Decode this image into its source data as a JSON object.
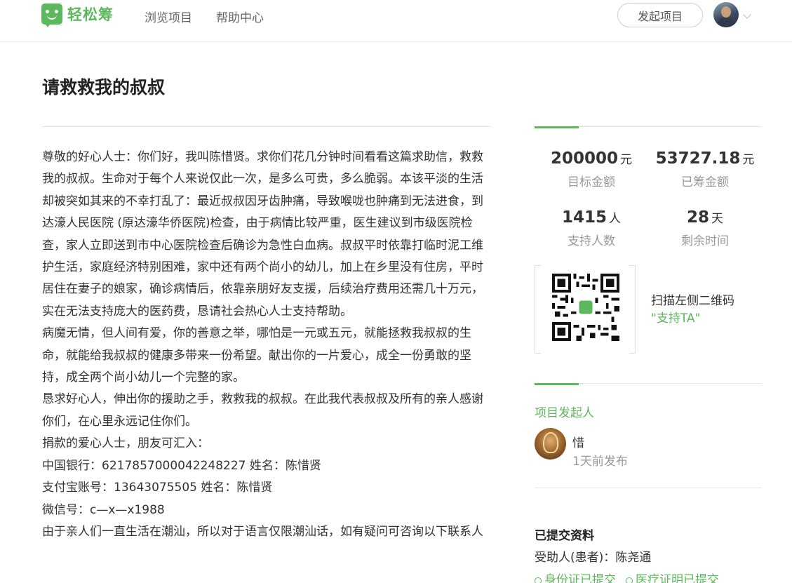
{
  "header": {
    "logo_text": "轻松筹",
    "nav": [
      "浏览项目",
      "帮助中心"
    ],
    "start_button": "发起项目"
  },
  "page_title": "请救救我的叔叔",
  "story": [
    "尊敬的好心人士：你们好，我叫陈惜贤。求你们花几分钟时间看看这篇求助信，救救我的叔叔。生命对于每个人来说仅此一次，是多么可贵，多么脆弱。本该平淡的生活却被突如其来的不幸打乱了：最近叔叔因牙齿肿痛，导致喉咙也肿痛到无法进食，到达濠人民医院 (原达濠华侨医院)检查，由于病情比较严重，医生建议到市级医院检查，家人立即送到市中心医院检查后确诊为急性白血病。叔叔平时依靠打临时泥工维护生活，家庭经济特别困难，家中还有两个尚小的幼儿，加上在乡里没有住房，平时居住在妻子的娘家，确诊病情后，依靠亲朋好友支援，后续治疗费用还需几十万元，实在无法支持庞大的医药费，恳请社会热心人士支持帮助。",
    "病魔无情，但人间有爱，你的善意之举，哪怕是一元或五元，就能拯救我叔叔的生命，就能给我叔叔的健康多带来一份希望。献出你的一片爱心，成全一份勇敢的坚持，成全两个尚小幼儿一个完整的家。",
    "恳求好心人，伸出你的援助之手，救救我的叔叔。在此我代表叔叔及所有的亲人感谢你们，在心里永远记住你们。",
    "捐款的爱心人士，朋友可汇入：",
    "中国银行：6217857000042248227 姓名：陈惜贤",
    "支付宝账号：13643075505 姓名：陈惜贤",
    "微信号：c—x—x1988",
    "由于亲人们一直生活在潮汕，所以对于语言仅限潮汕话，如有疑问可咨询以下联系人"
  ],
  "stats": {
    "target": {
      "value": "200000",
      "unit": "元",
      "label": "目标金额"
    },
    "raised": {
      "value": "53727.18",
      "unit": "元",
      "label": "已筹金额"
    },
    "supporters": {
      "value": "1415",
      "unit": "人",
      "label": "支持人数"
    },
    "remaining": {
      "value": "28",
      "unit": "天",
      "label": "剩余时间"
    }
  },
  "qr": {
    "line1": "扫描左侧二维码",
    "line2": "\"支持TA\""
  },
  "initiator": {
    "section_title": "项目发起人",
    "name": "惜",
    "time": "1天前发布"
  },
  "docs": {
    "title": "已提交资料",
    "beneficiary": "受助人(患者)：陈尧通",
    "badges": [
      "身份证已提交",
      "医疗证明已提交"
    ]
  },
  "colors": {
    "accent": "#5cb85c",
    "text": "#333333",
    "muted": "#999999"
  }
}
